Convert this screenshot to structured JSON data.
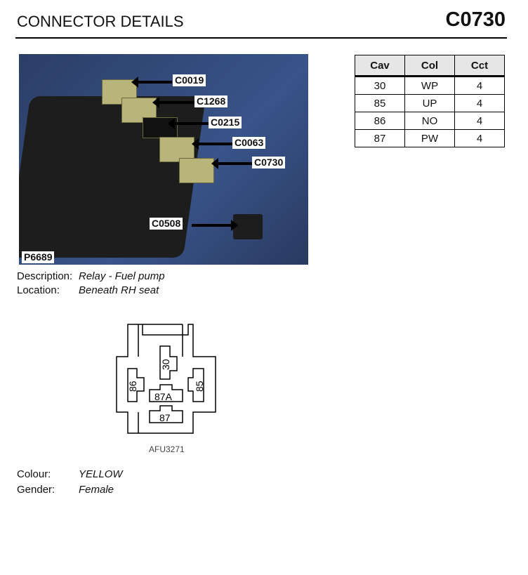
{
  "header": {
    "title": "CONNECTOR DETAILS",
    "connector": "C0730"
  },
  "photo": {
    "id": "P6689",
    "callouts": [
      "C0019",
      "C1268",
      "C0215",
      "C0063",
      "C0730",
      "C0508"
    ]
  },
  "details": {
    "description_label": "Description:",
    "description": "Relay - Fuel pump",
    "location_label": "Location:",
    "location": "Beneath RH seat"
  },
  "table": {
    "headers": [
      "Cav",
      "Col",
      "Cct"
    ],
    "rows": [
      [
        "30",
        "WP",
        "4"
      ],
      [
        "85",
        "UP",
        "4"
      ],
      [
        "86",
        "NO",
        "4"
      ],
      [
        "87",
        "PW",
        "4"
      ]
    ]
  },
  "diagram": {
    "pins": [
      "30",
      "86",
      "85",
      "87A",
      "87"
    ],
    "ref": "AFU3271"
  },
  "info": {
    "colour_label": "Colour:",
    "colour": "YELLOW",
    "gender_label": "Gender:",
    "gender": "Female"
  }
}
